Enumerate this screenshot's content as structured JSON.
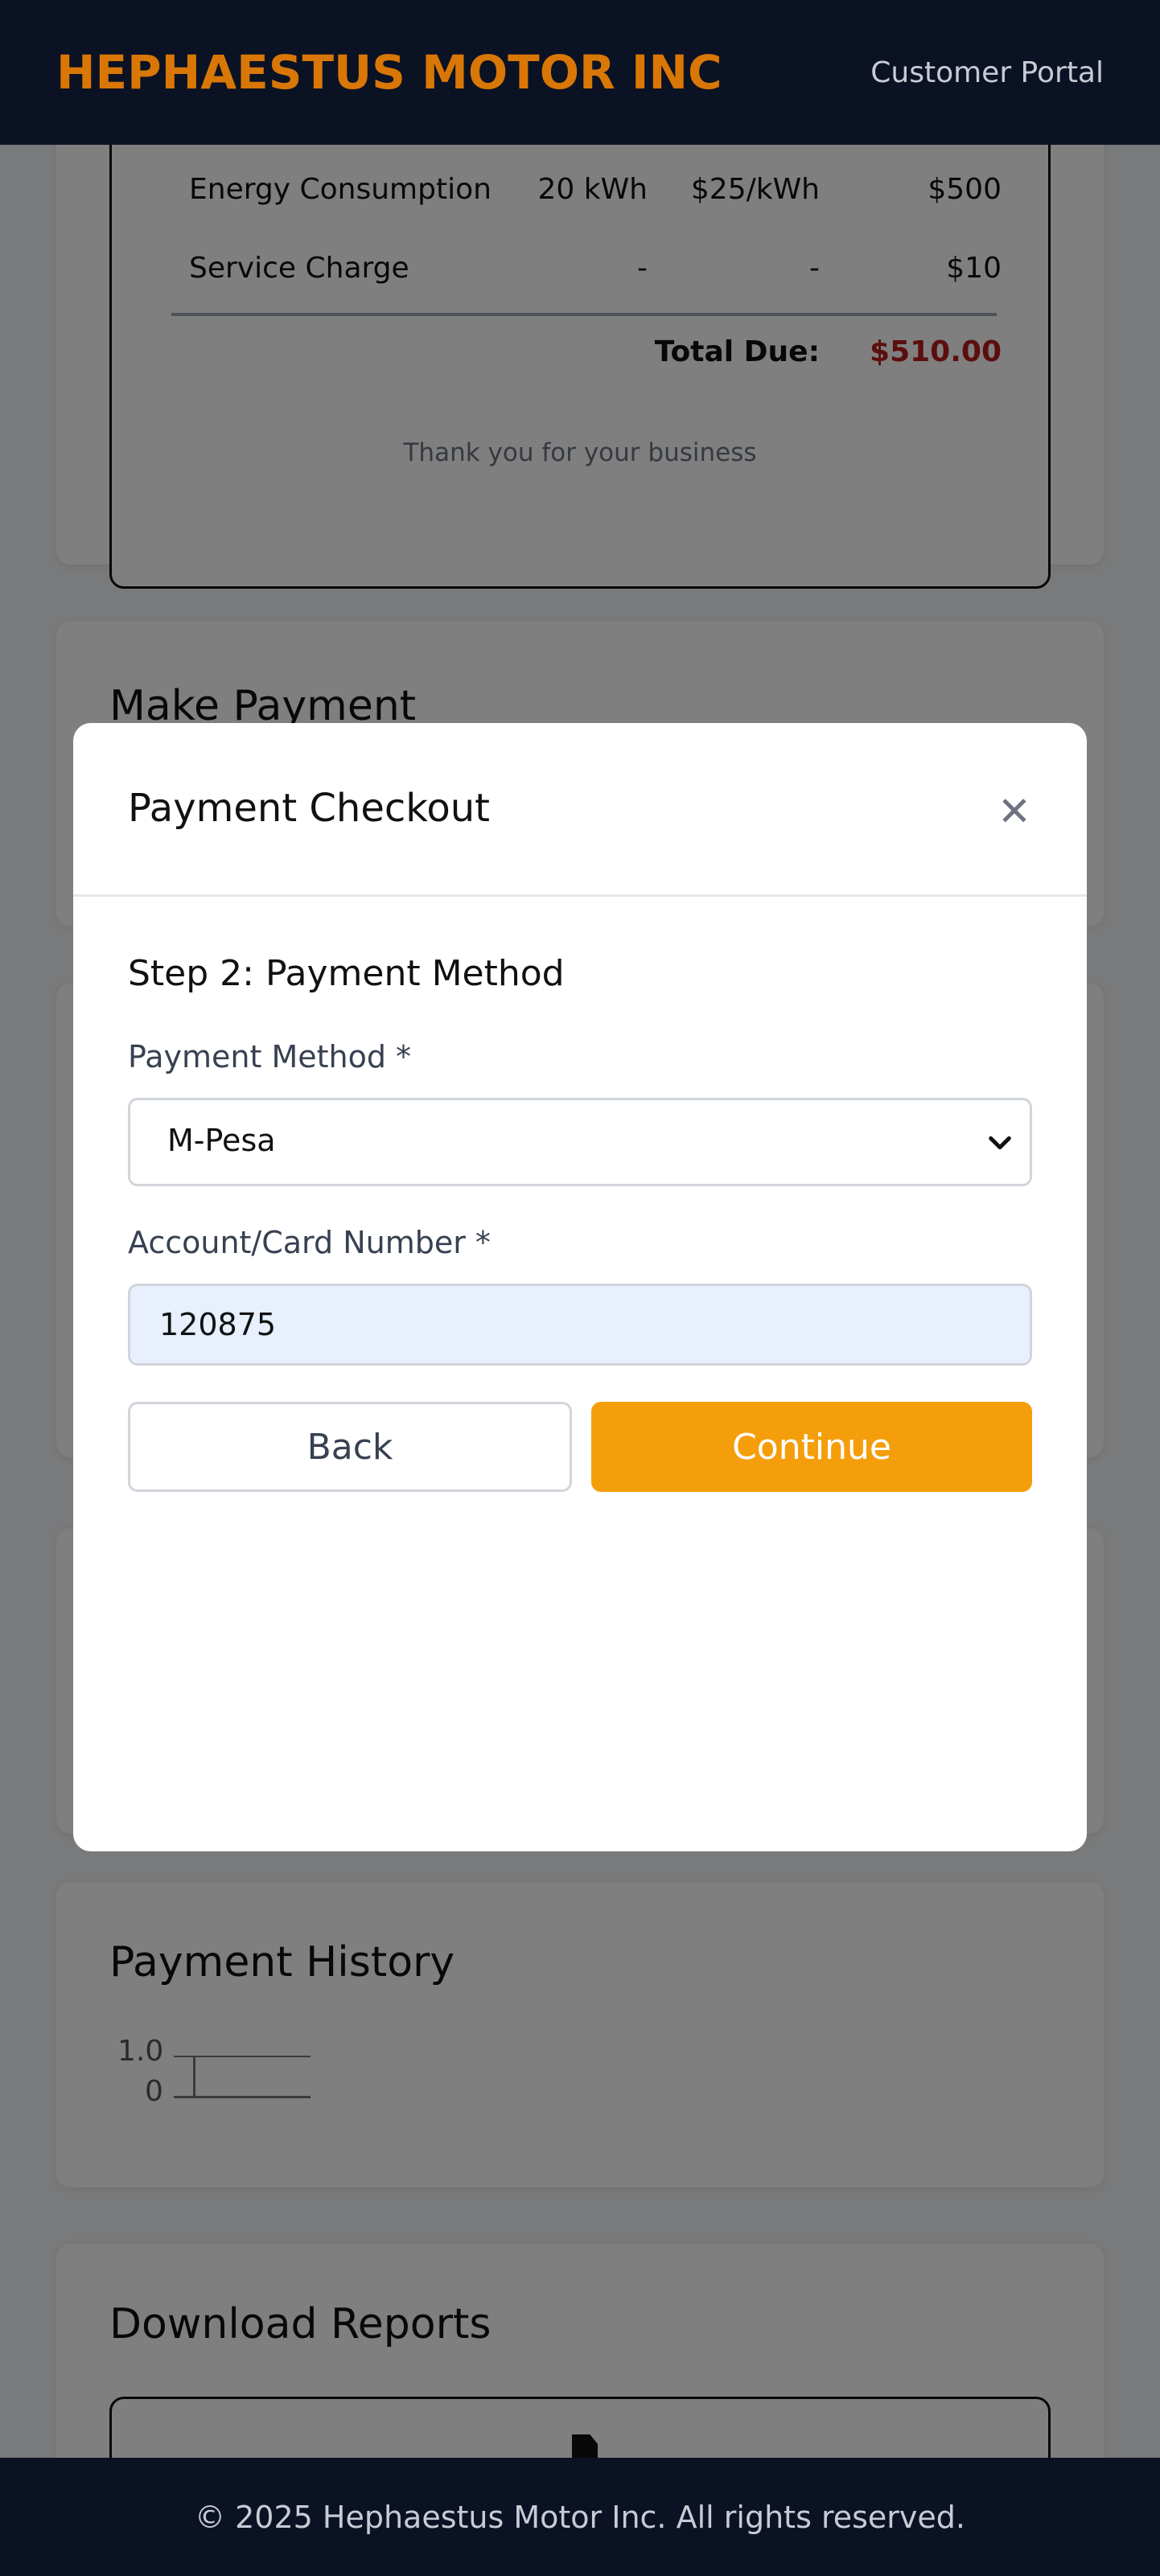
{
  "header": {
    "brand": "HEPHAESTUS MOTOR INC",
    "portal_label": "Customer Portal"
  },
  "invoice": {
    "rows": [
      {
        "item": "Energy Consumption",
        "quantity": "20 kWh",
        "rate": "$25/kWh",
        "amount": "$500"
      },
      {
        "item": "Service Charge",
        "quantity": "-",
        "rate": "-",
        "amount": "$10"
      }
    ],
    "total_label": "Total Due:",
    "total_value": "$510.00",
    "thanks": "Thank you for your business"
  },
  "make_payment": {
    "title": "Make Payment"
  },
  "payment_history": {
    "title": "Payment History",
    "chart_data": {
      "type": "line",
      "x": [],
      "y": [],
      "ylim": [
        0,
        1.0
      ],
      "yticks": [
        "1.0",
        "0"
      ]
    }
  },
  "download_reports": {
    "title": "Download Reports",
    "icon": "document-icon"
  },
  "modal": {
    "title": "Payment Checkout",
    "close_icon": "close-icon",
    "step_title": "Step 2: Payment Method",
    "method_label": "Payment Method *",
    "method_value": "M-Pesa",
    "account_label": "Account/Card Number *",
    "account_value": "120875",
    "back_label": "Back",
    "continue_label": "Continue"
  },
  "footer": {
    "text": "© 2025 Hephaestus Motor Inc. All rights reserved."
  },
  "colors": {
    "brand": "#d97706",
    "header_bg": "#0b1224",
    "accent": "#f59e0b",
    "total": "#b91c1c"
  }
}
